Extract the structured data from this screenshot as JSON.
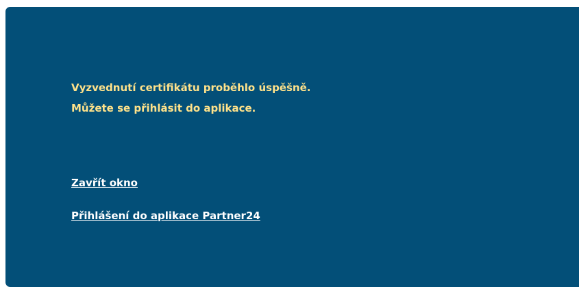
{
  "panel": {
    "background_color": "#034f78"
  },
  "message": {
    "line1": "Vyzvednutí certifikátu proběhlo úspěšně.",
    "line2": "Můžete se přihlásit do aplikace.",
    "text_color": "#ffe28a"
  },
  "links": {
    "close_window": "Zavřít okno",
    "login_app": "Přihlášení do aplikace Partner24",
    "link_color": "#ffffff"
  }
}
